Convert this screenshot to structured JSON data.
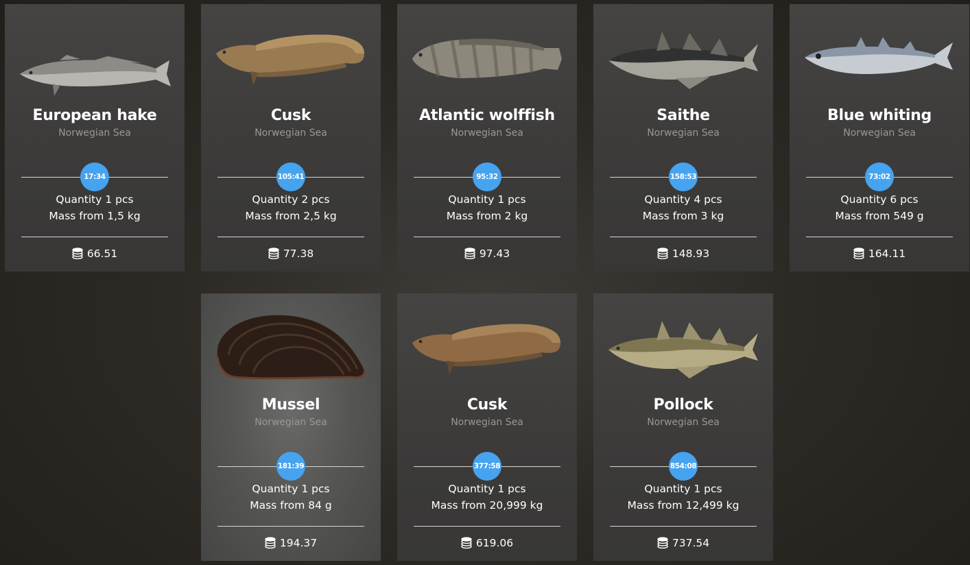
{
  "cards": [
    {
      "name": "European hake",
      "region": "Norwegian Sea",
      "time": "17:34",
      "quantity": "Quantity 1 pcs",
      "mass": "Mass from 1,5 kg",
      "price": "66.51",
      "icon": "european-hake-image"
    },
    {
      "name": "Cusk",
      "region": "Norwegian Sea",
      "time": "105:41",
      "quantity": "Quantity 2 pcs",
      "mass": "Mass from 2,5 kg",
      "price": "77.38",
      "icon": "cusk-image"
    },
    {
      "name": "Atlantic wolffish",
      "region": "Norwegian Sea",
      "time": "95:32",
      "quantity": "Quantity 1 pcs",
      "mass": "Mass from 2 kg",
      "price": "97.43",
      "icon": "atlantic-wolffish-image"
    },
    {
      "name": "Saithe",
      "region": "Norwegian Sea",
      "time": "158:53",
      "quantity": "Quantity 4 pcs",
      "mass": "Mass from 3 kg",
      "price": "148.93",
      "icon": "saithe-image"
    },
    {
      "name": "Blue whiting",
      "region": "Norwegian Sea",
      "time": "73:02",
      "quantity": "Quantity 6 pcs",
      "mass": "Mass from 549 g",
      "price": "164.11",
      "icon": "blue-whiting-image"
    },
    {
      "name": "Mussel",
      "region": "Norwegian Sea",
      "time": "181:39",
      "quantity": "Quantity 1 pcs",
      "mass": "Mass from 84 g",
      "price": "194.37",
      "icon": "mussel-image"
    },
    {
      "name": "Cusk",
      "region": "Norwegian Sea",
      "time": "377:58",
      "quantity": "Quantity 1 pcs",
      "mass": "Mass from 20,999 kg",
      "price": "619.06",
      "icon": "cusk-image"
    },
    {
      "name": "Pollock",
      "region": "Norwegian Sea",
      "time": "854:08",
      "quantity": "Quantity 1 pcs",
      "mass": "Mass from 12,499 kg",
      "price": "737.54",
      "icon": "pollock-image"
    }
  ],
  "colors": {
    "timer_badge": "#46a3f0",
    "card_background": "#3f3e3d",
    "region_text": "#9a9896"
  }
}
